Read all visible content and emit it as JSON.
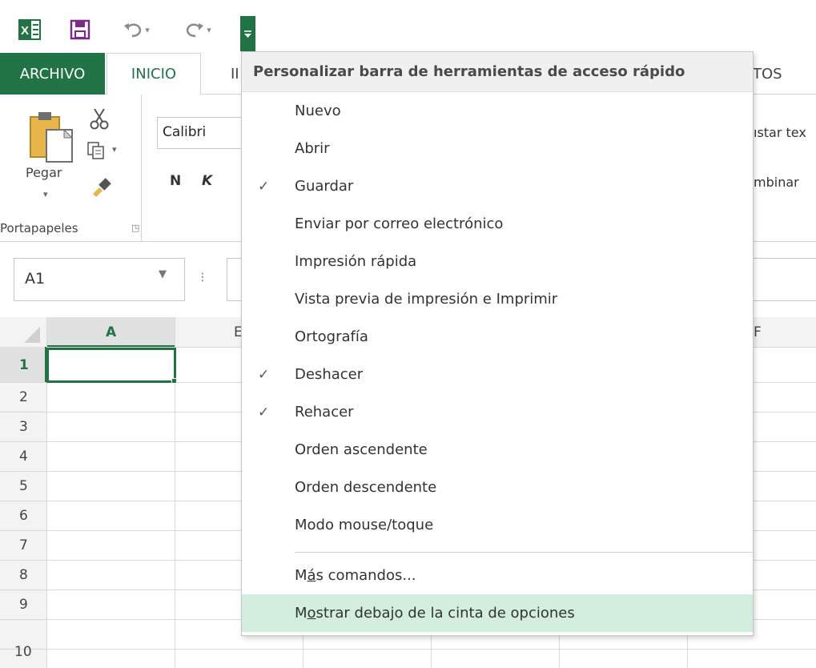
{
  "qat": {
    "excel_icon": "excel-icon",
    "save_icon": "save-icon",
    "undo_icon": "undo-icon",
    "redo_icon": "redo-icon",
    "customize_icon": "customize-qat-icon"
  },
  "tabs": {
    "archivo": "ARCHIVO",
    "inicio": "INICIO",
    "insertar_partial": "II",
    "datos_partial": "TOS"
  },
  "ribbon": {
    "paste_label": "Pegar",
    "clipboard_group": "Portapapeles",
    "font_name": "Calibri",
    "bold": "N",
    "italic": "K",
    "wrap_text_partial": "ıstar tex",
    "merge_partial": "mbinar"
  },
  "formula_bar": {
    "name_box": "A1",
    "separator": "⁝"
  },
  "grid": {
    "col_a": "A",
    "col_b_partial": "E",
    "col_f_partial": "F",
    "rows": [
      "1",
      "2",
      "3",
      "4",
      "5",
      "6",
      "7",
      "8",
      "9",
      "10"
    ]
  },
  "menu": {
    "header": "Personalizar barra de herramientas de acceso rápido",
    "items": [
      {
        "label": "Nuevo",
        "checked": false
      },
      {
        "label": "Abrir",
        "checked": false
      },
      {
        "label": "Guardar",
        "checked": true
      },
      {
        "label": "Enviar por correo electrónico",
        "checked": false
      },
      {
        "label": "Impresión rápida",
        "checked": false
      },
      {
        "label": "Vista previa de impresión e Imprimir",
        "checked": false
      },
      {
        "label": "Ortografía",
        "checked": false
      },
      {
        "label": "Deshacer",
        "checked": true
      },
      {
        "label": "Rehacer",
        "checked": true
      },
      {
        "label": "Orden ascendente",
        "checked": false
      },
      {
        "label": "Orden descendente",
        "checked": false
      },
      {
        "label": "Modo mouse/toque",
        "checked": false
      }
    ],
    "more_commands_prefix": "M",
    "more_commands_mnemonic": "á",
    "more_commands_rest": "s comandos...",
    "show_below_prefix": "M",
    "show_below_mnemonic": "o",
    "show_below_rest": "strar debajo de la cinta de opciones",
    "check_glyph": "✓"
  },
  "colors": {
    "excel_green": "#217346",
    "highlight": "#d3eede",
    "save_purple": "#7a2b86"
  }
}
